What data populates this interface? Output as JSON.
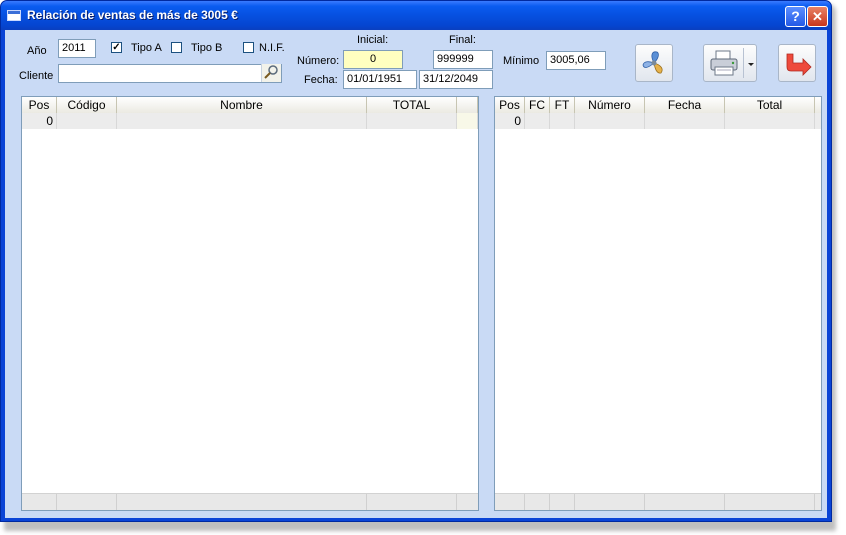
{
  "window": {
    "title": "Relación de ventas de más de 3005 €",
    "help_label": "?",
    "close_label": "✕"
  },
  "filters": {
    "year_label": "Año",
    "year_value": "2011",
    "tipo_a_label": "Tipo A",
    "tipo_a_checked": true,
    "tipo_b_label": "Tipo B",
    "tipo_b_checked": false,
    "nif_label": "N.I.F.",
    "nif_checked": false,
    "client_label": "Cliente",
    "client_value": "",
    "initial_header": "Inicial:",
    "final_header": "Final:",
    "number_label": "Número:",
    "number_initial": "0",
    "number_final": "999999",
    "date_label": "Fecha:",
    "date_initial": "01/01/1951",
    "date_final": "31/12/2049",
    "minimum_label": "Mínimo",
    "minimum_value": "3005,06"
  },
  "toolbar": {
    "fan_icon": "fan-icon",
    "print_icon": "printer-icon",
    "exit_icon": "exit-arrow-icon"
  },
  "left_grid": {
    "columns": [
      "Pos",
      "Código",
      "Nombre",
      "TOTAL"
    ],
    "rows": [
      {
        "pos": "0",
        "codigo": "",
        "nombre": "",
        "total": ""
      }
    ]
  },
  "right_grid": {
    "columns": [
      "Pos",
      "FC",
      "FT",
      "Número",
      "Fecha",
      "Total"
    ],
    "rows": [
      {
        "pos": "0",
        "fc": "",
        "ft": "",
        "numero": "",
        "fecha": "",
        "total": ""
      }
    ]
  },
  "colors": {
    "titlebar": "#0650e0",
    "client_bg": "#c9daf5",
    "highlight_field": "#ffffc0",
    "exit_arrow": "#e8413a"
  }
}
